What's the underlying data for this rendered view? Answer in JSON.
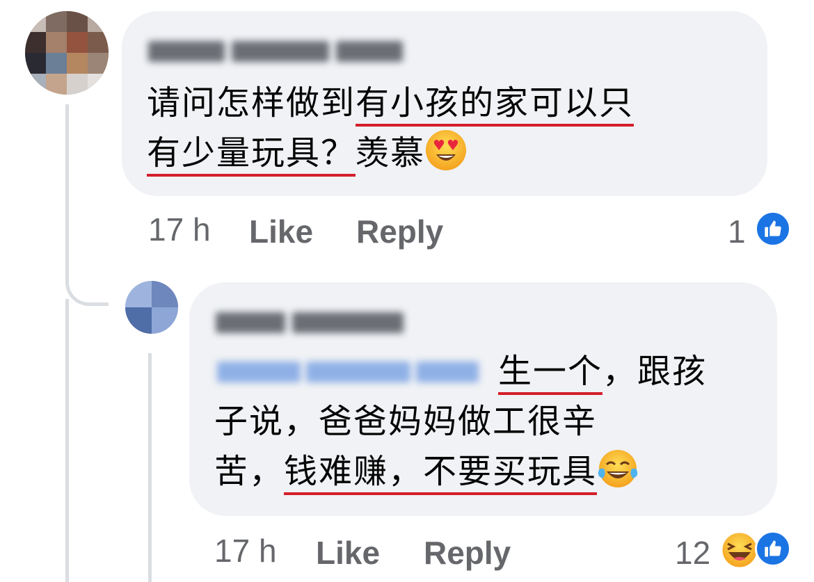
{
  "comment": {
    "author_name": "",
    "text": {
      "part1": "请问怎样做到",
      "part2_underlined": "有小孩的家可以只",
      "part3_underlined": "有少量玩具？",
      "part4": "羡慕"
    },
    "emoji": "heart-eyes-emoji",
    "timestamp": "17 h",
    "like_label": "Like",
    "reply_label": "Reply",
    "reaction_count": "1",
    "reaction_types": [
      "like"
    ]
  },
  "reply": {
    "author_name": "",
    "mention": "",
    "text": {
      "line1_underlined": "生一个",
      "line1_rest": "，跟孩",
      "line2": "子说，爸爸妈妈做工很辛",
      "line3_start": "苦，",
      "line3_underlined": "钱难赚，不要买玩具"
    },
    "emoji": "tears-of-joy-emoji",
    "timestamp": "17 h",
    "like_label": "Like",
    "reply_label": "Reply",
    "reaction_count": "12",
    "reaction_types": [
      "haha",
      "like"
    ]
  },
  "colors": {
    "bubble": "#f0f2f5",
    "meta_text": "#65676b",
    "underline": "#d41e2a",
    "like_blue": "#1b74e4",
    "thread_line": "#dadde1"
  }
}
